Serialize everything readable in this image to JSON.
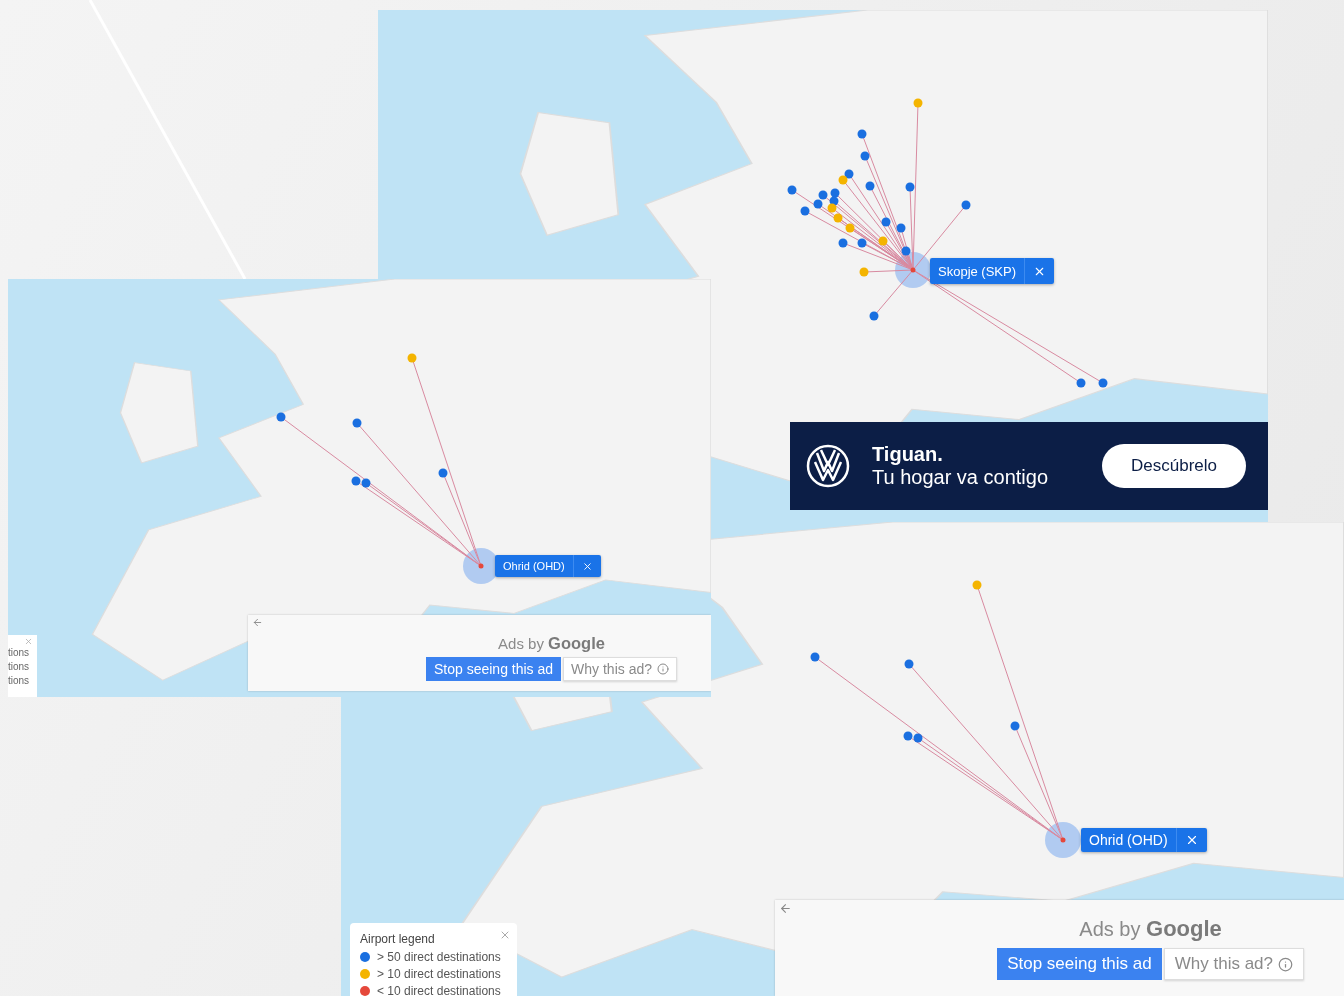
{
  "top_map": {
    "popup": "Skopje (SKP)",
    "ad_banner": {
      "title": "Tiguan.",
      "subtitle": "Tu hogar va contigo",
      "button": "Descúbrelo"
    }
  },
  "left_map": {
    "popup": "Ohrid (OHD)",
    "legend_fragment": [
      "tions",
      "tions",
      "tions"
    ],
    "ads": {
      "heading": "Ads by **Google**",
      "stop_button": "Stop seeing this ad",
      "why_button": "Why this ad?"
    }
  },
  "bottom_map": {
    "popup": "Ohrid (OHD)",
    "legend": {
      "title": "Airport legend",
      "items": [
        {
          "label": "> 50 direct destinations",
          "color": "#1a6fe0"
        },
        {
          "label": "> 10 direct destinations",
          "color": "#f4b400"
        },
        {
          "label": "< 10 direct destinations",
          "color": "#e5483b"
        }
      ]
    },
    "ads": {
      "heading": "Ads by **Google**",
      "stop_button": "Stop seeing this ad",
      "why_button": "Why this ad?"
    }
  }
}
